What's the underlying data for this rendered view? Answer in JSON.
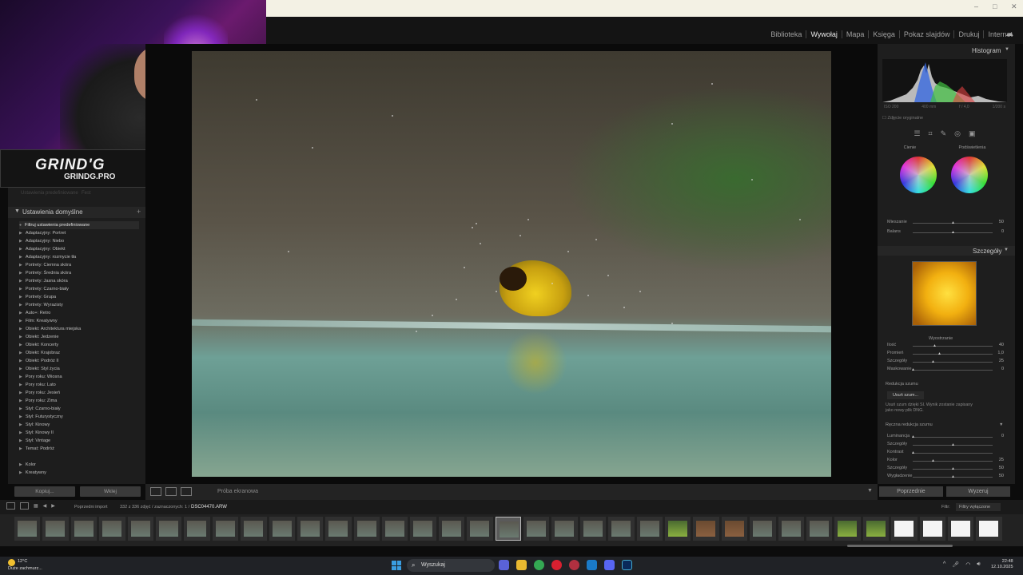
{
  "window": {
    "minimize": "–",
    "maximize": "□",
    "close": "✕"
  },
  "modules": [
    "Biblioteka",
    "Wywołaj",
    "Mapa",
    "Księga",
    "Pokaz slajdów",
    "Drukuj",
    "Internet"
  ],
  "active_module": "Wywołaj",
  "overlay": {
    "logo": "GRIND'G",
    "logo_sub": "GRINDG.PRO"
  },
  "left_panel": {
    "faded_top": [
      "Ustawienia predefiniowane",
      "Fest"
    ],
    "presets_title": "Ustawienia domyślne",
    "filter_label": "Filtruj ustawienia predefiniowane",
    "presets": [
      "Adaptacyjny: Portret",
      "Adaptacyjny: Niebo",
      "Adaptacyjny: Obiekt",
      "Adaptacyjny: rozmycie tła",
      "Portrety: Ciemna skóra",
      "Portrety: Średnia skóra",
      "Portrety: Jasna skóra",
      "Portrety: Czarno-biały",
      "Portrety: Grupa",
      "Portrety: Wyrazisty",
      "Auto+: Retro",
      "Film: Kreatywny",
      "Obiekt: Architektura miejska",
      "Obiekt: Jedzenie",
      "Obiekt: Koncerty",
      "Obiekt: Krajobraz",
      "Obiekt: Podróż II",
      "Obiekt: Styl życia",
      "Pory roku: Wiosna",
      "Pory roku: Lato",
      "Pory roku: Jesień",
      "Pory roku: Zima",
      "Styl: Czarno-biały",
      "Styl: Futurystyczny",
      "Styl: Kinowy",
      "Styl: Kinowy II",
      "Styl: Vintage",
      "Temat: Podróż"
    ],
    "presets_extra": [
      "Kolor",
      "Kreatywny"
    ],
    "copy_button": "Kopiuj...",
    "paste_button": "Wklej"
  },
  "toolbar": {
    "proof_label": "Próba ekranowa"
  },
  "right_panel": {
    "histogram_title": "Histogram",
    "hist_info": [
      "ISO 200",
      "400 mm",
      "f / 4,0",
      "1/200 s"
    ],
    "original_photo": "Zdjęcie oryginalne",
    "grade_labels": [
      "Cienie",
      "Podświetlenia"
    ],
    "grade_sliders": [
      {
        "label": "Mieszanie",
        "value": "50",
        "pos": 0.5
      },
      {
        "label": "Balans",
        "value": "0",
        "pos": 0.5
      }
    ],
    "details_title": "Szczegóły",
    "sharpening_label": "Wyostrzanie",
    "sharpening": [
      {
        "label": "Ilość",
        "value": "40",
        "pos": 0.27
      },
      {
        "label": "Promień",
        "value": "1,0",
        "pos": 0.33
      },
      {
        "label": "Szczegóły",
        "value": "25",
        "pos": 0.25
      },
      {
        "label": "Maskowanie",
        "value": "0",
        "pos": 0.0
      }
    ],
    "noise_title": "Redukcja szumu",
    "denoise_button": "Usuń szum...",
    "denoise_note": "Usuń szum dzięki SI. Wynik zostanie zapisany jako nowy plik DNG.",
    "manual_noise_title": "Ręczna redukcja szumu",
    "manual_noise": [
      {
        "label": "Luminancja",
        "value": "0",
        "pos": 0.0
      },
      {
        "label": "Szczegóły",
        "value": "",
        "pos": 0.5
      },
      {
        "label": "Kontrast",
        "value": "",
        "pos": 0.0
      },
      {
        "label": "Kolor",
        "value": "25",
        "pos": 0.25
      },
      {
        "label": "Szczegóły",
        "value": "50",
        "pos": 0.5
      },
      {
        "label": "Wygładzenie",
        "value": "50",
        "pos": 0.5
      }
    ],
    "prev_button": "Poprzednie",
    "reset_button": "Wyzeruj"
  },
  "filmstrip": {
    "source": "Poprzedni import",
    "count": "332 z 336 zdjęć / zaznaczonych: 1 /",
    "filename": "DSC04470.ARW",
    "filter_label": "Filtr:",
    "filter_value": "Filtry wyłączone"
  },
  "taskbar": {
    "weather_temp": "12°C",
    "weather_desc": "Duże zachmurz...",
    "search": "Wyszukaj",
    "time": "22:48",
    "date": "12.10.2025"
  }
}
